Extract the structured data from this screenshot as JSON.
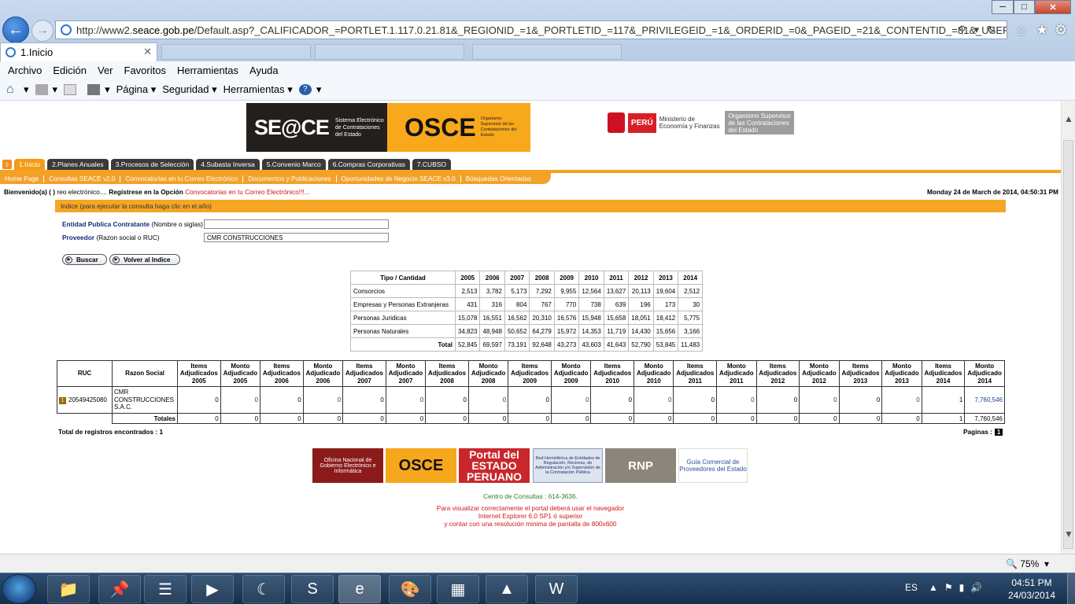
{
  "browser": {
    "url_prefix": "http://www2.",
    "url_domain": "seace.gob.pe",
    "url_rest": "/Default.asp?_CALIFICADOR_=PORTLET.1.117.0.21.81&_REGIONID_=1&_PORTLETID_=117&_PRIVILEGEID_=1&_ORDERID_=0&_PAGEID_=21&_CONTENTID_=81&_USERID_=%3C%21--USER",
    "tab_title": "1.Inicio",
    "menu": [
      "Archivo",
      "Edición",
      "Ver",
      "Favoritos",
      "Herramientas",
      "Ayuda"
    ],
    "commands": {
      "pagina": "Página",
      "seguridad": "Seguridad",
      "herramientas": "Herramientas"
    },
    "zoom": "75%"
  },
  "banner": {
    "seace": "SE@CE",
    "seace_sub": "Sistema Electrónico de Contrataciones del Estado",
    "osce": "OSCE",
    "osce_sub": "Organismo Supervisor de las Contrataciones del Estado",
    "mef_peru": "PERÚ",
    "mef_ministerio": "Ministerio de Economía y Finanzas",
    "mef_organismo": "Organismo Supervisor de las Contrataciones del Estado"
  },
  "tabs": [
    "1.Inicio",
    "2.Planes Anuales",
    "3.Procesos de Selección",
    "4.Subasta Inversa",
    "5.Convenio Marco",
    "6.Compras Corporativas",
    "7.CUBSO"
  ],
  "subnav": [
    "Home Page",
    "Consultas SEACE v2.0",
    "Convocatorias en tu Correo Electrónico",
    "Documentos y Publicaciones",
    "Oportunidades de Negocio SEACE v3.0",
    "Búsquedas Orientadas"
  ],
  "welcome": {
    "part1": "Bienvenido(a) ( ) ",
    "part2": "reo electrónico.... ",
    "part3": "Registrese en la Opción ",
    "part4": "Convocatorias en tu Correo Electrónico!!!..."
  },
  "datetime": "Monday 24 de March de 2014, 04:50:31 PM",
  "index_bar": "Indice (para ejecutar la consulta haga clic en el año)",
  "form": {
    "entidad_label": "Entidad Publica Contratante",
    "entidad_hint": " (Nombre o siglas)",
    "entidad_value": "",
    "proveedor_label": "Proveedor",
    "proveedor_hint": " (Razon social o RUC)",
    "proveedor_value": "CMR CONSTRUCCIONES",
    "buscar": "Buscar",
    "volver": "Volver al Indice"
  },
  "summary": {
    "header": "Tipo / Cantidad",
    "years": [
      "2005",
      "2006",
      "2007",
      "2008",
      "2009",
      "2010",
      "2011",
      "2012",
      "2013",
      "2014"
    ],
    "rows": [
      {
        "label": "Consorcios",
        "values": [
          "2,513",
          "3,782",
          "5,173",
          "7,292",
          "9,955",
          "12,564",
          "13,627",
          "20,113",
          "19,604",
          "2,512"
        ]
      },
      {
        "label": "Empresas y Personas Extranjeras",
        "values": [
          "431",
          "316",
          "804",
          "767",
          "770",
          "738",
          "639",
          "196",
          "173",
          "30"
        ]
      },
      {
        "label": "Personas Juridicas",
        "values": [
          "15,078",
          "16,551",
          "16,562",
          "20,310",
          "16,576",
          "15,948",
          "15,658",
          "18,051",
          "18,412",
          "5,775"
        ]
      },
      {
        "label": "Personas Naturales",
        "values": [
          "34,823",
          "48,948",
          "50,652",
          "64,279",
          "15,972",
          "14,353",
          "11,719",
          "14,430",
          "15,656",
          "3,166"
        ]
      }
    ],
    "total_label": "Total",
    "totals": [
      "52,845",
      "69,597",
      "73,191",
      "92,648",
      "43,273",
      "43,603",
      "41,643",
      "52,790",
      "53,845",
      "11,483"
    ]
  },
  "detail": {
    "col_ruc": "RUC",
    "col_razon": "Razon Social",
    "col_item": "Items Adjudicados",
    "col_monto": "Monto Adjudicado",
    "years": [
      "2005",
      "2006",
      "2007",
      "2008",
      "2009",
      "2010",
      "2011",
      "2012",
      "2013",
      "2014"
    ],
    "row": {
      "badge": "1",
      "ruc": "20549425080",
      "razon": "CMR CONSTRUCCIONES S.A.C.",
      "values": [
        "0",
        "0",
        "0",
        "0",
        "0",
        "0",
        "0",
        "0",
        "0",
        "0",
        "0",
        "0",
        "0",
        "0",
        "0",
        "0",
        "0",
        "0",
        "1",
        "7,760,546"
      ]
    },
    "totales_label": "Totales",
    "totales": [
      "0",
      "0",
      "0",
      "0",
      "0",
      "0",
      "0",
      "0",
      "0",
      "0",
      "0",
      "0",
      "0",
      "0",
      "0",
      "0",
      "0",
      "0",
      "1",
      "7,760,546"
    ]
  },
  "total_registros": "Total de registros encontrados : 1",
  "paginas_label": "Paginas :",
  "paginas_current": "1",
  "footer": {
    "logo_onggei": "Oficina Nacional de Gobierno Electrónico e Informática",
    "logo_osce": "OSCE",
    "logo_portal": "Portal del ESTADO PERUANO",
    "logo_red": "Red Hemisférica de Entidades de Regulación, Rectoras, de Administración y/o Supervisión de la Contratación Pública",
    "logo_rnp": "RNP",
    "logo_guia": "Guía Comercial de Proveedores del Estado",
    "consultas": "Centro de Consultas : 614-3636.",
    "line1": "Para visualizar correctamente el portal deberá usar el navegador",
    "line2": "Internet Explorer 6.0 SP1 ó superior",
    "line3": "y contar con una resolución minima de pantalla de 800x600"
  },
  "taskbar": {
    "lang": "ES",
    "time": "04:51 PM",
    "date": "24/03/2014"
  }
}
